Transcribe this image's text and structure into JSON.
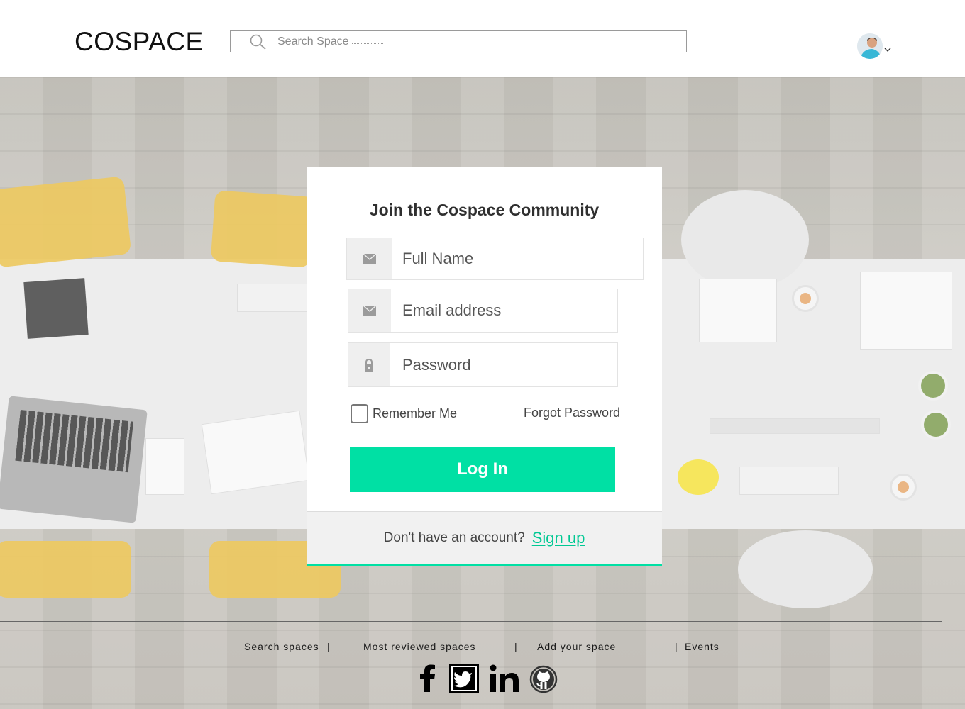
{
  "header": {
    "logo": "COSPACE",
    "search_placeholder": "Search Space"
  },
  "card": {
    "title": "Join the Cospace Community",
    "fields": {
      "full_name_placeholder": "Full Name",
      "email_placeholder": "Email address",
      "password_placeholder": "Password"
    },
    "remember_me": "Remember Me",
    "forgot_password": "Forgot Password",
    "login_button": "Log In",
    "no_account": "Don't have an account?",
    "sign_up": "Sign up"
  },
  "footer": {
    "links": [
      "Search spaces",
      "Most reviewed spaces",
      "Add your space",
      "Events"
    ],
    "separator": "|",
    "social_icons": [
      "facebook-icon",
      "twitter-icon",
      "linkedin-icon",
      "github-icon"
    ]
  },
  "colors": {
    "accent": "#00e0a4",
    "signup_link": "#00c893"
  }
}
